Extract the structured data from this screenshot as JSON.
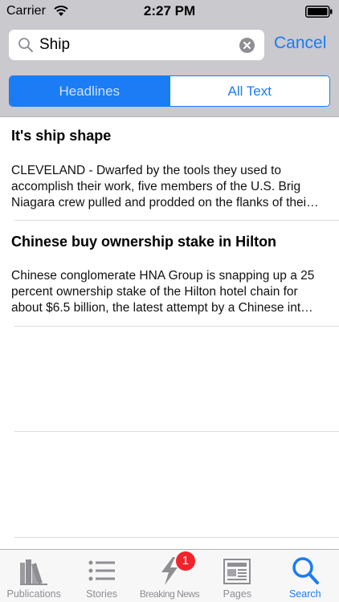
{
  "status_bar": {
    "carrier": "Carrier",
    "time": "2:27 PM",
    "wifi_icon": "wifi-icon",
    "battery_icon": "battery-icon"
  },
  "search": {
    "value": "Ship",
    "placeholder": "",
    "cancel_label": "Cancel",
    "search_icon": "search-icon",
    "clear_icon": "clear-icon"
  },
  "segments": [
    {
      "label": "Headlines",
      "selected": true
    },
    {
      "label": "All Text",
      "selected": false
    }
  ],
  "results": [
    {
      "title": "It's ship shape",
      "lines": [
        "CLEVELAND - Dwarfed by the tools they used to",
        "accomplish their work, five members of the U.S. Brig",
        "Niagara crew pulled and prodded on the flanks of thei…"
      ]
    },
    {
      "title": "Chinese buy ownership stake in Hilton",
      "lines": [
        "Chinese conglomerate HNA Group is snapping up a 25",
        "percent ownership stake of the Hilton hotel chain for",
        "about $6.5 billion, the latest attempt by a Chinese int…"
      ]
    }
  ],
  "tab_bar": {
    "tabs": [
      {
        "label": "Publications",
        "icon": "books-icon",
        "selected": false
      },
      {
        "label": "Stories",
        "icon": "list-icon",
        "selected": false
      },
      {
        "label": "Breaking News",
        "icon": "lightning-icon",
        "selected": false,
        "badge": "1"
      },
      {
        "label": "Pages",
        "icon": "newspaper-icon",
        "selected": false
      },
      {
        "label": "Search",
        "icon": "search-icon",
        "selected": true
      }
    ]
  },
  "colors": {
    "accent": "#1b7cf5",
    "bar_background": "#c9c9ce",
    "badge": "#f0242a",
    "tab_inactive": "#8e8e93"
  }
}
